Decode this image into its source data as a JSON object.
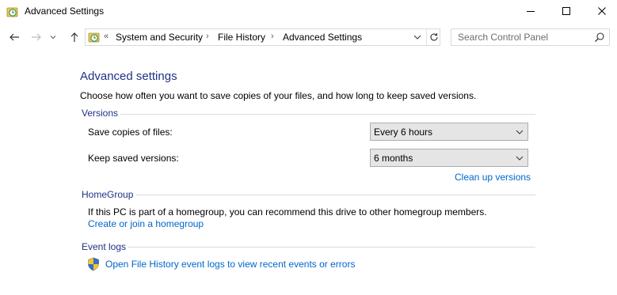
{
  "window": {
    "title": "Advanced Settings"
  },
  "navigation": {
    "breadcrumb": [
      "System and Security",
      "File History",
      "Advanced Settings"
    ],
    "overflow_chevron": "«",
    "separator": "›"
  },
  "search": {
    "placeholder": "Search Control Panel"
  },
  "content": {
    "heading": "Advanced settings",
    "description": "Choose how often you want to save copies of your files, and how long to keep saved versions.",
    "versions": {
      "group_label": "Versions",
      "save_copies_label": "Save copies of files:",
      "save_copies_value": "Every 6 hours",
      "keep_versions_label": "Keep saved versions:",
      "keep_versions_value": "6 months",
      "clean_up_link": "Clean up versions"
    },
    "homegroup": {
      "group_label": "HomeGroup",
      "text": "If this PC is part of a homegroup, you can recommend this drive to other homegroup members.",
      "link": "Create or join a homegroup"
    },
    "event_logs": {
      "group_label": "Event logs",
      "link": "Open File History event logs to view recent events or errors"
    }
  },
  "colors": {
    "heading": "#1e3287",
    "link": "#0066cc",
    "select_bg": "#e5e5e5"
  }
}
